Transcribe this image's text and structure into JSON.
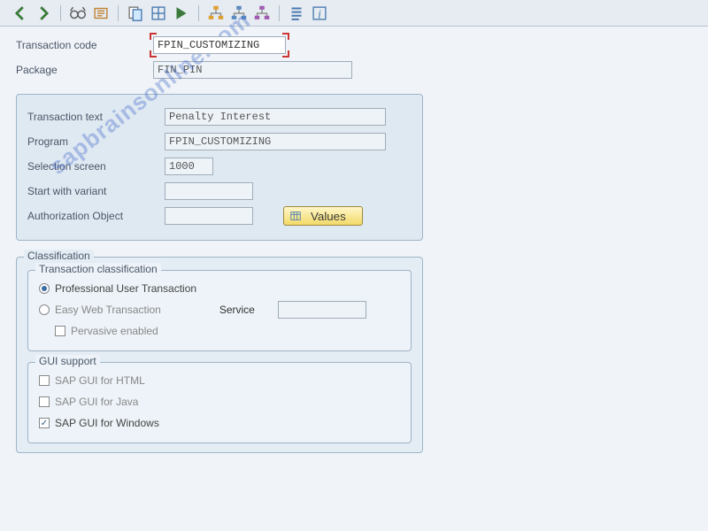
{
  "toolbar": {
    "icons": [
      "back",
      "forward",
      "glasses",
      "copy",
      "paste",
      "tree",
      "refresh",
      "arrow",
      "hier1",
      "hier2",
      "hier3",
      "list",
      "info"
    ]
  },
  "watermark": "sapbrainsonline.com",
  "header": {
    "tcode_label": "Transaction code",
    "tcode_value": "FPIN_CUSTOMIZING",
    "package_label": "Package",
    "package_value": "FIN_PIN"
  },
  "details": {
    "text_label": "Transaction text",
    "text_value": "Penalty Interest",
    "program_label": "Program",
    "program_value": "FPIN_CUSTOMIZING",
    "selscreen_label": "Selection screen",
    "selscreen_value": "1000",
    "variant_label": "Start with variant",
    "variant_value": "",
    "authobj_label": "Authorization Object",
    "authobj_value": "",
    "values_btn": "Values"
  },
  "classification": {
    "legend": "Classification",
    "tc_legend": "Transaction classification",
    "opt_pro": "Professional User Transaction",
    "opt_easy": "Easy Web Transaction",
    "service_label": "Service",
    "service_value": "",
    "pervasive": "Pervasive enabled",
    "gui_legend": "GUI support",
    "gui_html": "SAP GUI for HTML",
    "gui_java": "SAP GUI for Java",
    "gui_win": "SAP GUI for Windows"
  }
}
